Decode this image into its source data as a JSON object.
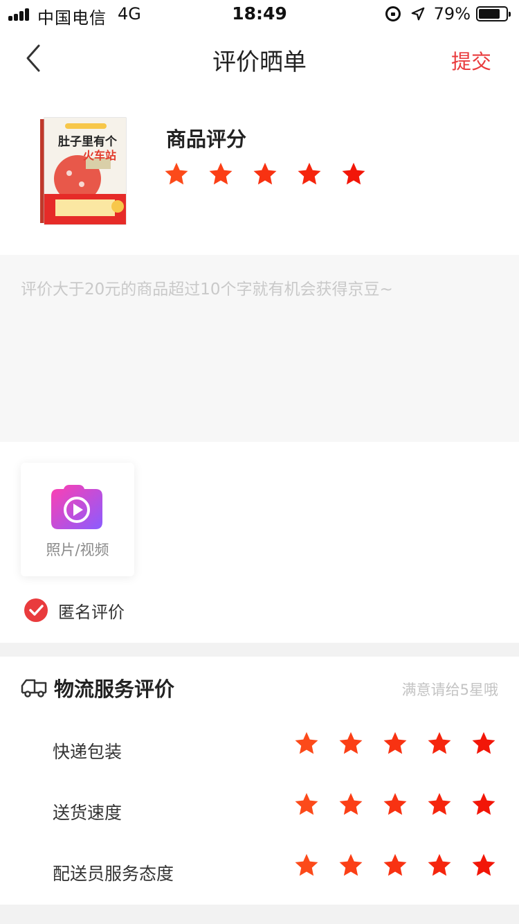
{
  "status_bar": {
    "carrier": "中国电信",
    "network": "4G",
    "time": "18:49",
    "battery": "79%",
    "battery_level": 0.79
  },
  "nav": {
    "title": "评价晒单",
    "submit_label": "提交",
    "accent_color": "#e93b3d"
  },
  "product": {
    "rating_label": "商品评分",
    "rating": 5,
    "star_colors": [
      "#fc4a1a",
      "#fb3f16",
      "#f83212",
      "#f5250d",
      "#f21608"
    ],
    "book_cover": {
      "title_line1": "肚子里有个",
      "title_line2": "火车站"
    }
  },
  "review": {
    "placeholder": "评价大于20元的商品超过10个字就有机会获得京豆~",
    "value": ""
  },
  "upload": {
    "label": "照片/视频",
    "icon": "camera-video-icon"
  },
  "anonymous": {
    "label": "匿名评价",
    "checked": true
  },
  "logistics": {
    "title": "物流服务评价",
    "hint": "满意请给5星哦",
    "icon": "truck-icon",
    "items": [
      {
        "label": "快递包装",
        "rating": 5
      },
      {
        "label": "送货速度",
        "rating": 5
      },
      {
        "label": "配送员服务态度",
        "rating": 5
      }
    ]
  }
}
